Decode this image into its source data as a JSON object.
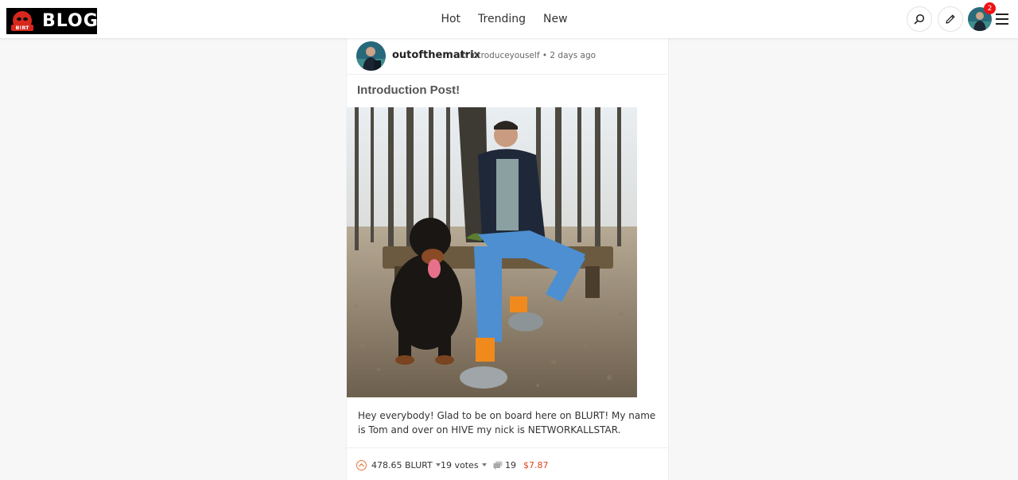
{
  "header": {
    "logo_text": "BLOG",
    "logo_badge_text": "B!RT",
    "nav": [
      {
        "label": "Hot"
      },
      {
        "label": "Trending"
      },
      {
        "label": "New"
      }
    ],
    "notification_count": "2",
    "icons": [
      "search-icon",
      "pencil-icon",
      "menu-icon"
    ]
  },
  "post": {
    "author": "outofthematrix",
    "meta_prefix": "in",
    "community": "introduceyouself",
    "separator": "•",
    "age": "2 days ago",
    "title": "Introduction Post!",
    "excerpt": "Hey everybody! Glad to be on board here on BLURT! My name is Tom and over on HIVE my nick is NETWORKALLSTAR.",
    "payout": "478.65 BLURT",
    "votes": "19 votes",
    "comments": "19",
    "value": "$7.87"
  },
  "colors": {
    "accent": "#e8743b",
    "value_red": "#e0421b",
    "badge_red": "#e11111"
  }
}
